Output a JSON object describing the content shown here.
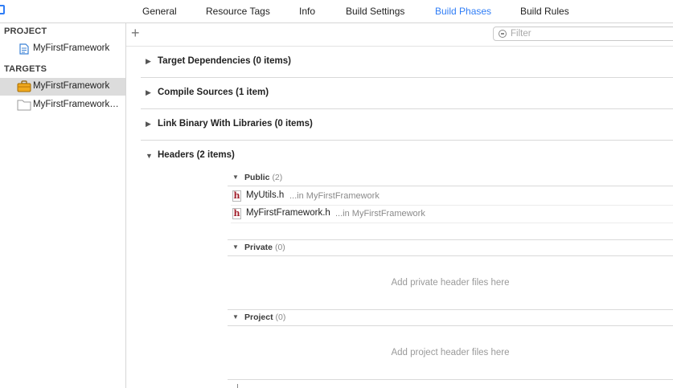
{
  "tabs": [
    {
      "label": "General",
      "active": false
    },
    {
      "label": "Resource Tags",
      "active": false
    },
    {
      "label": "Info",
      "active": false
    },
    {
      "label": "Build Settings",
      "active": false
    },
    {
      "label": "Build Phases",
      "active": true
    },
    {
      "label": "Build Rules",
      "active": false
    }
  ],
  "sidebar": {
    "project_header": "PROJECT",
    "project_item": "MyFirstFramework",
    "targets_header": "TARGETS",
    "targets": [
      {
        "label": "MyFirstFramework",
        "selected": true,
        "icon": "framework-toolbox-icon"
      },
      {
        "label": "MyFirstFrameworkTests",
        "selected": false,
        "icon": "test-bundle-icon"
      }
    ]
  },
  "toolbar": {
    "add_label": "+",
    "filter_placeholder": "Filter"
  },
  "phases": [
    {
      "title": "Target Dependencies (0 items)",
      "expanded": false
    },
    {
      "title": "Compile Sources (1 item)",
      "expanded": false
    },
    {
      "title": "Link Binary With Libraries (0 items)",
      "expanded": false
    },
    {
      "title": "Headers (2 items)",
      "expanded": true
    }
  ],
  "headers": {
    "public": {
      "title": "Public",
      "count": "(2)",
      "files": [
        {
          "name": "MyUtils.h",
          "location": "...in MyFirstFramework"
        },
        {
          "name": "MyFirstFramework.h",
          "location": "...in MyFirstFramework"
        }
      ]
    },
    "private": {
      "title": "Private",
      "count": "(0)",
      "empty_text": "Add private header files here"
    },
    "project": {
      "title": "Project",
      "count": "(0)",
      "empty_text": "Add project header files here"
    }
  },
  "colors": {
    "accent": "#2f7df6",
    "header_icon": "#a01f2b",
    "selection": "#dcdcdc"
  }
}
